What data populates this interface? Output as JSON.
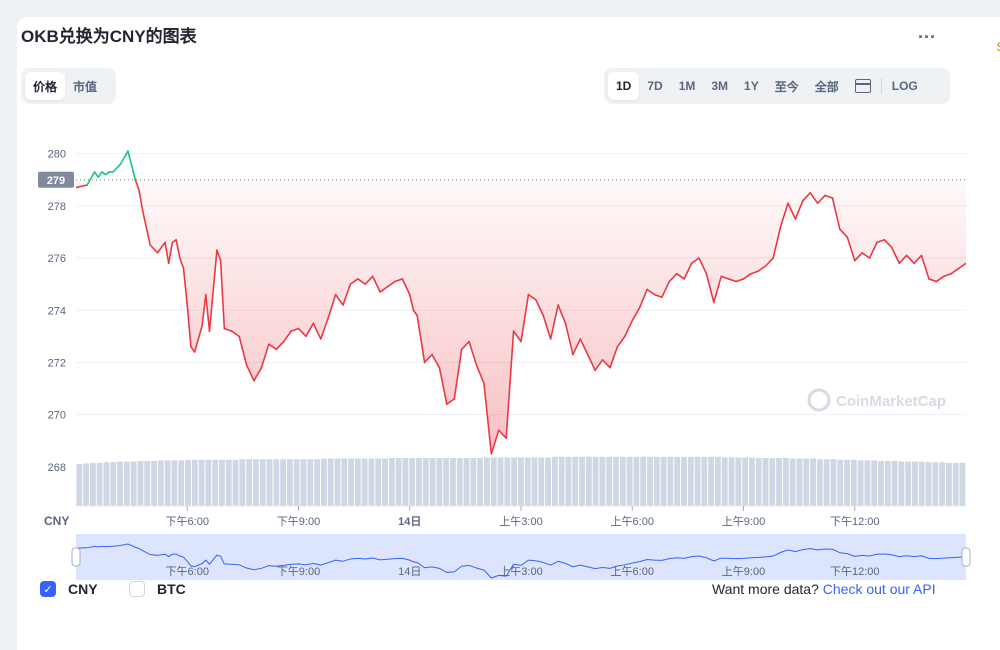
{
  "header": {
    "title": "OKB兑换为CNY的图表",
    "more_label": "...",
    "edge_glyph": "$"
  },
  "tabs_left": {
    "price_label": "价格",
    "market_cap_label": "市值",
    "active": "价格"
  },
  "ranges": {
    "items": [
      "1D",
      "7D",
      "1M",
      "3M",
      "1Y",
      "至今",
      "全部"
    ],
    "active": "1D",
    "log_label": "LOG"
  },
  "colors": {
    "up": "#16c784",
    "down": "#ea3943",
    "volume": "#cfd6e4",
    "navigator_line": "#3861fb",
    "navigator_fill": "#dde4fd",
    "accent": "#3861fb"
  },
  "legend": {
    "cny_label": "CNY",
    "cny_checked": true,
    "btc_label": "BTC",
    "btc_checked": false
  },
  "footer": {
    "api_text": "Want more data?",
    "api_link": "Check out our API"
  },
  "watermark": "CoinMarketCap",
  "chart_data": {
    "type": "line",
    "currency_label": "CNY",
    "ylim": [
      266.5,
      280.6
    ],
    "y_ticks": [
      280,
      278,
      276,
      274,
      272,
      270,
      268
    ],
    "reference_value": 279,
    "reference_label": "279",
    "x_tick_labels": [
      "下午6:00",
      "下午9:00",
      "14日",
      "上午3:00",
      "上午6:00",
      "上午9:00",
      "下午12:00"
    ],
    "x_tick_hours": [
      3,
      6,
      9,
      12,
      15,
      18,
      21
    ],
    "x_range_hours": [
      0,
      24
    ],
    "grid": true,
    "series": [
      {
        "x": [
          0,
          0.3,
          0.5,
          0.6,
          0.7,
          0.8,
          0.9,
          1.0,
          1.2,
          1.4,
          1.6,
          1.7,
          1.8,
          2.0,
          2.2,
          2.4,
          2.5,
          2.6,
          2.7,
          2.8,
          2.9,
          3.0,
          3.1,
          3.2,
          3.4,
          3.5,
          3.6,
          3.8,
          3.9,
          4.0,
          4.2,
          4.4,
          4.6,
          4.8,
          5.0,
          5.2,
          5.4,
          5.6,
          5.8,
          6.0,
          6.2,
          6.4,
          6.6,
          6.8,
          7.0,
          7.2,
          7.4,
          7.6,
          7.8,
          8.0,
          8.2,
          8.4,
          8.6,
          8.8,
          9.0,
          9.1,
          9.2,
          9.4,
          9.6,
          9.8,
          10.0,
          10.2,
          10.4,
          10.6,
          10.8,
          11.0,
          11.2,
          11.4,
          11.6,
          11.8,
          12.0,
          12.2,
          12.4,
          12.6,
          12.8,
          13.0,
          13.2,
          13.4,
          13.6,
          13.8,
          14.0,
          14.2,
          14.4,
          14.6,
          14.8,
          15.0,
          15.2,
          15.4,
          15.6,
          15.8,
          16.0,
          16.2,
          16.4,
          16.6,
          16.8,
          17.0,
          17.2,
          17.4,
          17.6,
          17.8,
          18.0,
          18.2,
          18.4,
          18.6,
          18.8,
          19.0,
          19.2,
          19.4,
          19.6,
          19.8,
          20.0,
          20.2,
          20.4,
          20.6,
          20.8,
          21.0,
          21.2,
          21.4,
          21.6,
          21.8,
          22.0,
          22.2,
          22.4,
          22.6,
          22.8,
          23.0,
          23.2,
          23.4,
          23.6,
          23.8,
          24.0
        ],
        "values": [
          278.7,
          278.8,
          279.3,
          279.1,
          279.3,
          279.2,
          279.3,
          279.3,
          279.6,
          280.1,
          279.0,
          278.6,
          277.8,
          276.5,
          276.2,
          276.6,
          275.8,
          276.6,
          276.7,
          276.0,
          275.6,
          274.2,
          272.6,
          272.4,
          273.4,
          274.6,
          273.2,
          276.3,
          275.9,
          273.3,
          273.2,
          273.0,
          271.9,
          271.3,
          271.8,
          272.7,
          272.5,
          272.8,
          273.2,
          273.3,
          273.0,
          273.5,
          272.9,
          273.7,
          274.6,
          274.2,
          275.0,
          275.2,
          275.0,
          275.3,
          274.7,
          274.9,
          275.1,
          275.2,
          274.6,
          274.0,
          273.8,
          272.0,
          272.3,
          271.8,
          270.4,
          270.6,
          272.5,
          272.8,
          271.9,
          271.2,
          268.5,
          269.4,
          269.1,
          273.2,
          272.8,
          274.6,
          274.4,
          273.8,
          272.9,
          274.2,
          273.5,
          272.3,
          272.9,
          272.3,
          271.7,
          272.1,
          271.8,
          272.6,
          273.0,
          273.6,
          274.1,
          274.8,
          274.6,
          274.5,
          275.1,
          275.4,
          275.2,
          275.8,
          276.0,
          275.4,
          274.3,
          275.3,
          275.2,
          275.1,
          275.2,
          275.4,
          275.5,
          275.7,
          276.0,
          277.2,
          278.1,
          277.5,
          278.2,
          278.5,
          278.1,
          278.4,
          278.3,
          277.1,
          276.8,
          275.9,
          276.2,
          276.0,
          276.6,
          276.7,
          276.4,
          275.8,
          276.1,
          275.8,
          276.1,
          275.2,
          275.1,
          275.3,
          275.4,
          275.6,
          275.8
        ],
        "volume": [
          0.7,
          0.71,
          0.72,
          0.72,
          0.73,
          0.73,
          0.74,
          0.74,
          0.74,
          0.75,
          0.75,
          0.75,
          0.76,
          0.76,
          0.76,
          0.76,
          0.77,
          0.77,
          0.77,
          0.77,
          0.77,
          0.77,
          0.77,
          0.77,
          0.78,
          0.78,
          0.78,
          0.78,
          0.78,
          0.78,
          0.78,
          0.78,
          0.78,
          0.78,
          0.78,
          0.78,
          0.79,
          0.79,
          0.79,
          0.79,
          0.79,
          0.79,
          0.79,
          0.79,
          0.79,
          0.79,
          0.8,
          0.8,
          0.8,
          0.8,
          0.8,
          0.8,
          0.8,
          0.8,
          0.8,
          0.8,
          0.8,
          0.8,
          0.8,
          0.8,
          0.81,
          0.81,
          0.81,
          0.81,
          0.81,
          0.81,
          0.81,
          0.81,
          0.81,
          0.81,
          0.82,
          0.82,
          0.82,
          0.82,
          0.82,
          0.82,
          0.82,
          0.82,
          0.82,
          0.82,
          0.82,
          0.82,
          0.82,
          0.82,
          0.82,
          0.82,
          0.82,
          0.82,
          0.82,
          0.82,
          0.82,
          0.82,
          0.82,
          0.82,
          0.82,
          0.81,
          0.81,
          0.81,
          0.81,
          0.81,
          0.8,
          0.8,
          0.8,
          0.8,
          0.8,
          0.79,
          0.79,
          0.79,
          0.79,
          0.78,
          0.78,
          0.78,
          0.77,
          0.77,
          0.77,
          0.76,
          0.76,
          0.76,
          0.75,
          0.75,
          0.75,
          0.74,
          0.74,
          0.74,
          0.74,
          0.73,
          0.73,
          0.73,
          0.72,
          0.72,
          0.72
        ]
      }
    ]
  }
}
